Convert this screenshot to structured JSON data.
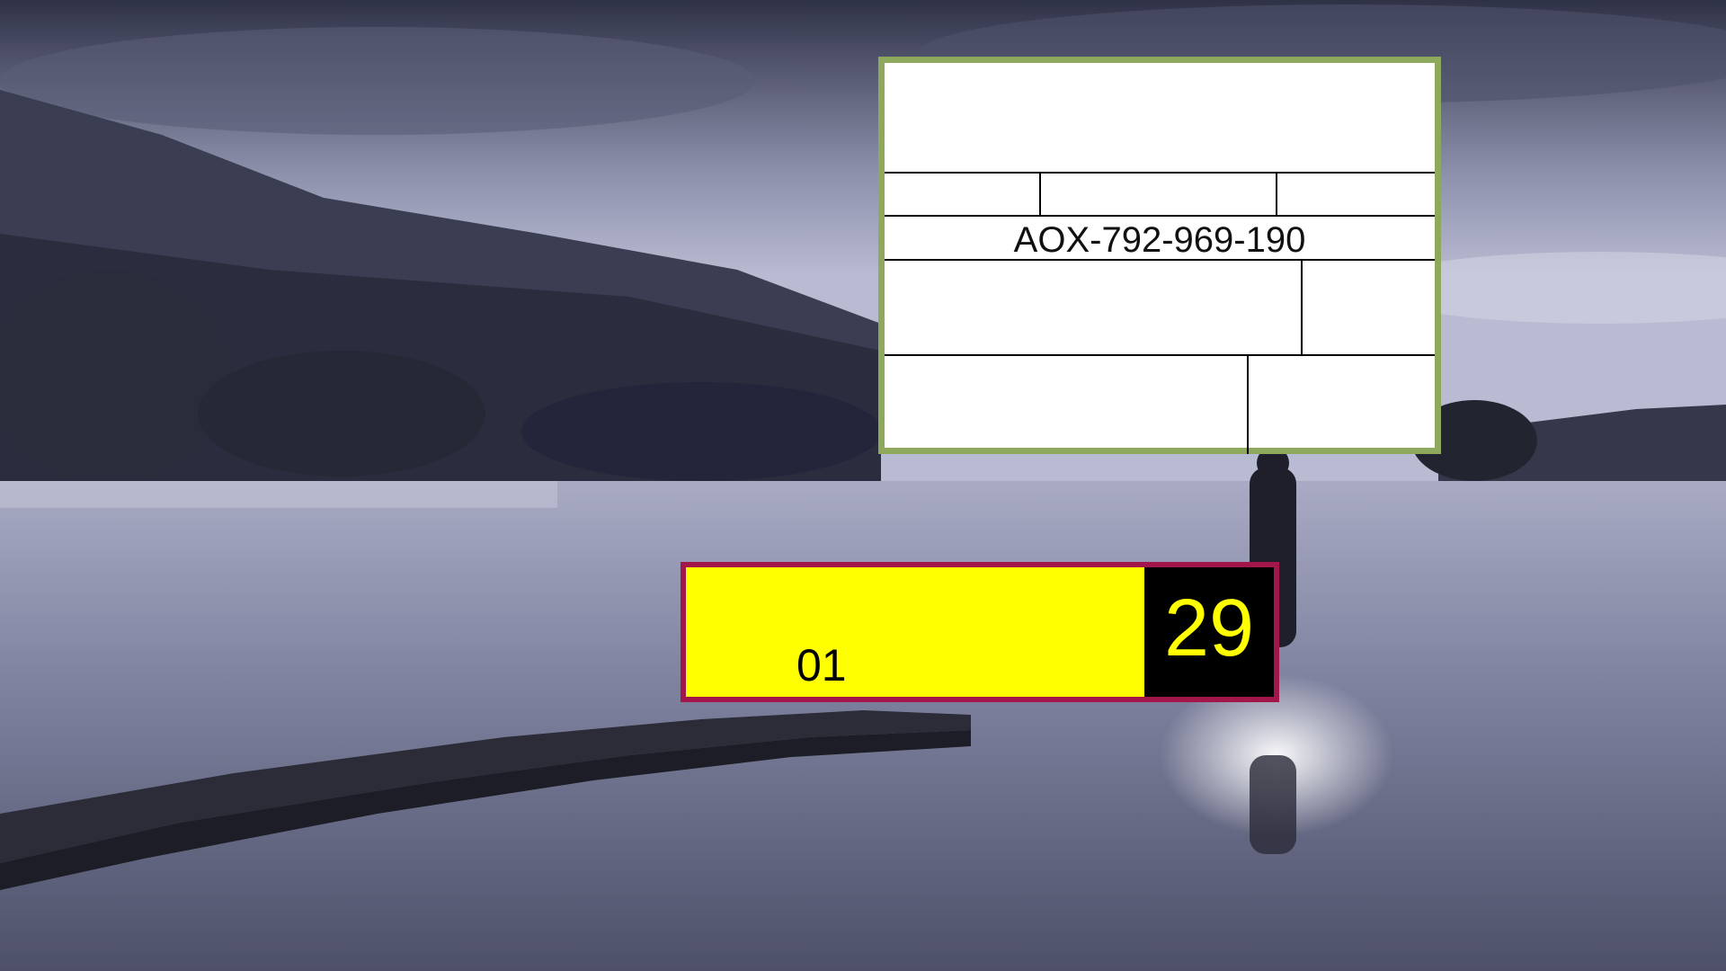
{
  "panel": {
    "code": "AOX-792-969-190",
    "border_color": "#8fa95c"
  },
  "scorebar": {
    "left_label": "01",
    "count": "29",
    "fill_color": "#ffff00",
    "border_color": "#a3164a",
    "count_bg": "#000000"
  },
  "background": {
    "scene": "misty lake with hills, trees, stepping stones and a standing person"
  }
}
